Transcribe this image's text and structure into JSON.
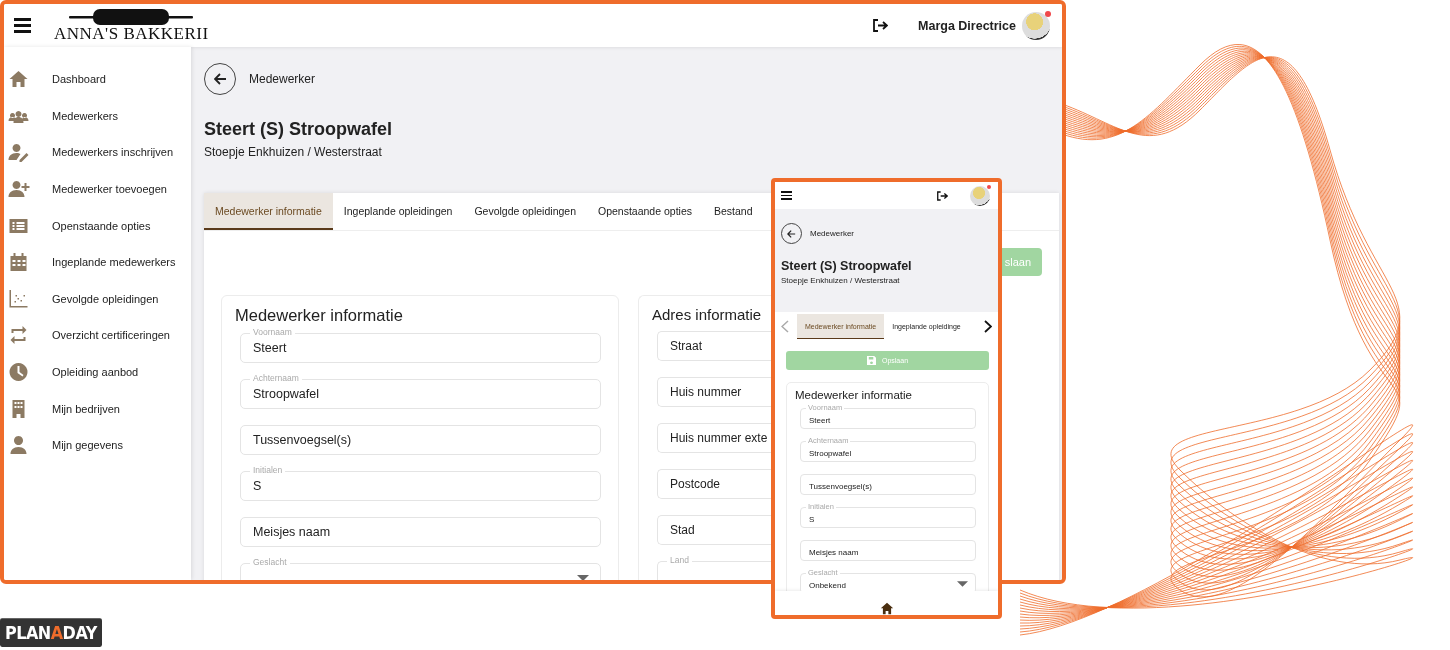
{
  "app_header": {
    "brand": "ANNA'S BAKKERII",
    "user_name": "Marga Directrice",
    "notification": true
  },
  "sidebar": {
    "items": [
      {
        "label": "Dashboard"
      },
      {
        "label": "Medewerkers"
      },
      {
        "label": "Medewerkers inschrijven"
      },
      {
        "label": "Medewerker toevoegen"
      },
      {
        "label": "Openstaande opties"
      },
      {
        "label": "Ingeplande medewerkers"
      },
      {
        "label": "Gevolgde opleidingen"
      },
      {
        "label": "Overzicht certificeringen"
      },
      {
        "label": "Opleiding aanbod"
      },
      {
        "label": "Mijn bedrijven"
      },
      {
        "label": "Mijn gegevens"
      }
    ]
  },
  "page": {
    "back_label": "Medewerker",
    "title": "Steert (S) Stroopwafel",
    "subtitle": "Stoepje Enkhuizen / Westerstraat",
    "tabs": [
      {
        "label": "Medewerker informatie",
        "selected": true
      },
      {
        "label": "Ingeplande opleidingen",
        "selected": false
      },
      {
        "label": "Gevolgde opleidingen",
        "selected": false
      },
      {
        "label": "Openstaande opties",
        "selected": false
      },
      {
        "label": "Bestand",
        "selected": false
      }
    ],
    "save_button": "slaan",
    "sections": [
      {
        "title": "Medewerker informatie",
        "fields": [
          {
            "kind": "text",
            "label": "Voornaam",
            "value": "Steert"
          },
          {
            "kind": "text",
            "label": "Achternaam",
            "value": "Stroopwafel"
          },
          {
            "kind": "text",
            "placeholder": "Tussenvoegsel(s)"
          },
          {
            "kind": "text",
            "label": "Initialen",
            "value": "S"
          },
          {
            "kind": "text",
            "placeholder": "Meisjes naam"
          },
          {
            "kind": "select",
            "label": "Geslacht"
          }
        ]
      },
      {
        "title": "Adres informatie",
        "fields": [
          {
            "kind": "text",
            "placeholder": "Straat"
          },
          {
            "kind": "text",
            "placeholder": "Huis nummer"
          },
          {
            "kind": "text",
            "placeholder": "Huis nummer exte"
          },
          {
            "kind": "text",
            "placeholder": "Postcode"
          },
          {
            "kind": "text",
            "placeholder": "Stad"
          },
          {
            "kind": "text",
            "label": "Land"
          }
        ]
      }
    ]
  },
  "mobile": {
    "notification": true,
    "back_label": "Medewerker",
    "title": "Steert (S) Stroopwafel",
    "subtitle": "Stoepje Enkhuizen / Westerstraat",
    "tabs": [
      {
        "label": "Medewerker informatie",
        "selected": true
      },
      {
        "label": "Ingeplande opleidinge",
        "selected": false
      }
    ],
    "save_button": "Opslaan",
    "section": {
      "title": "Medewerker informatie",
      "fields": [
        {
          "kind": "text",
          "label": "Voornaam",
          "value": "Steert"
        },
        {
          "kind": "text",
          "label": "Achternaam",
          "value": "Stroopwafel"
        },
        {
          "kind": "text",
          "placeholder": "Tussenvoegsel(s)"
        },
        {
          "kind": "text",
          "label": "Initialen",
          "value": "S"
        },
        {
          "kind": "text",
          "placeholder": "Meisjes naam"
        },
        {
          "kind": "select",
          "label": "Geslacht",
          "value": "Onbekend"
        }
      ]
    }
  },
  "brand_logo": {
    "before": "PLAN",
    "accent": "A",
    "after": "DAY"
  }
}
